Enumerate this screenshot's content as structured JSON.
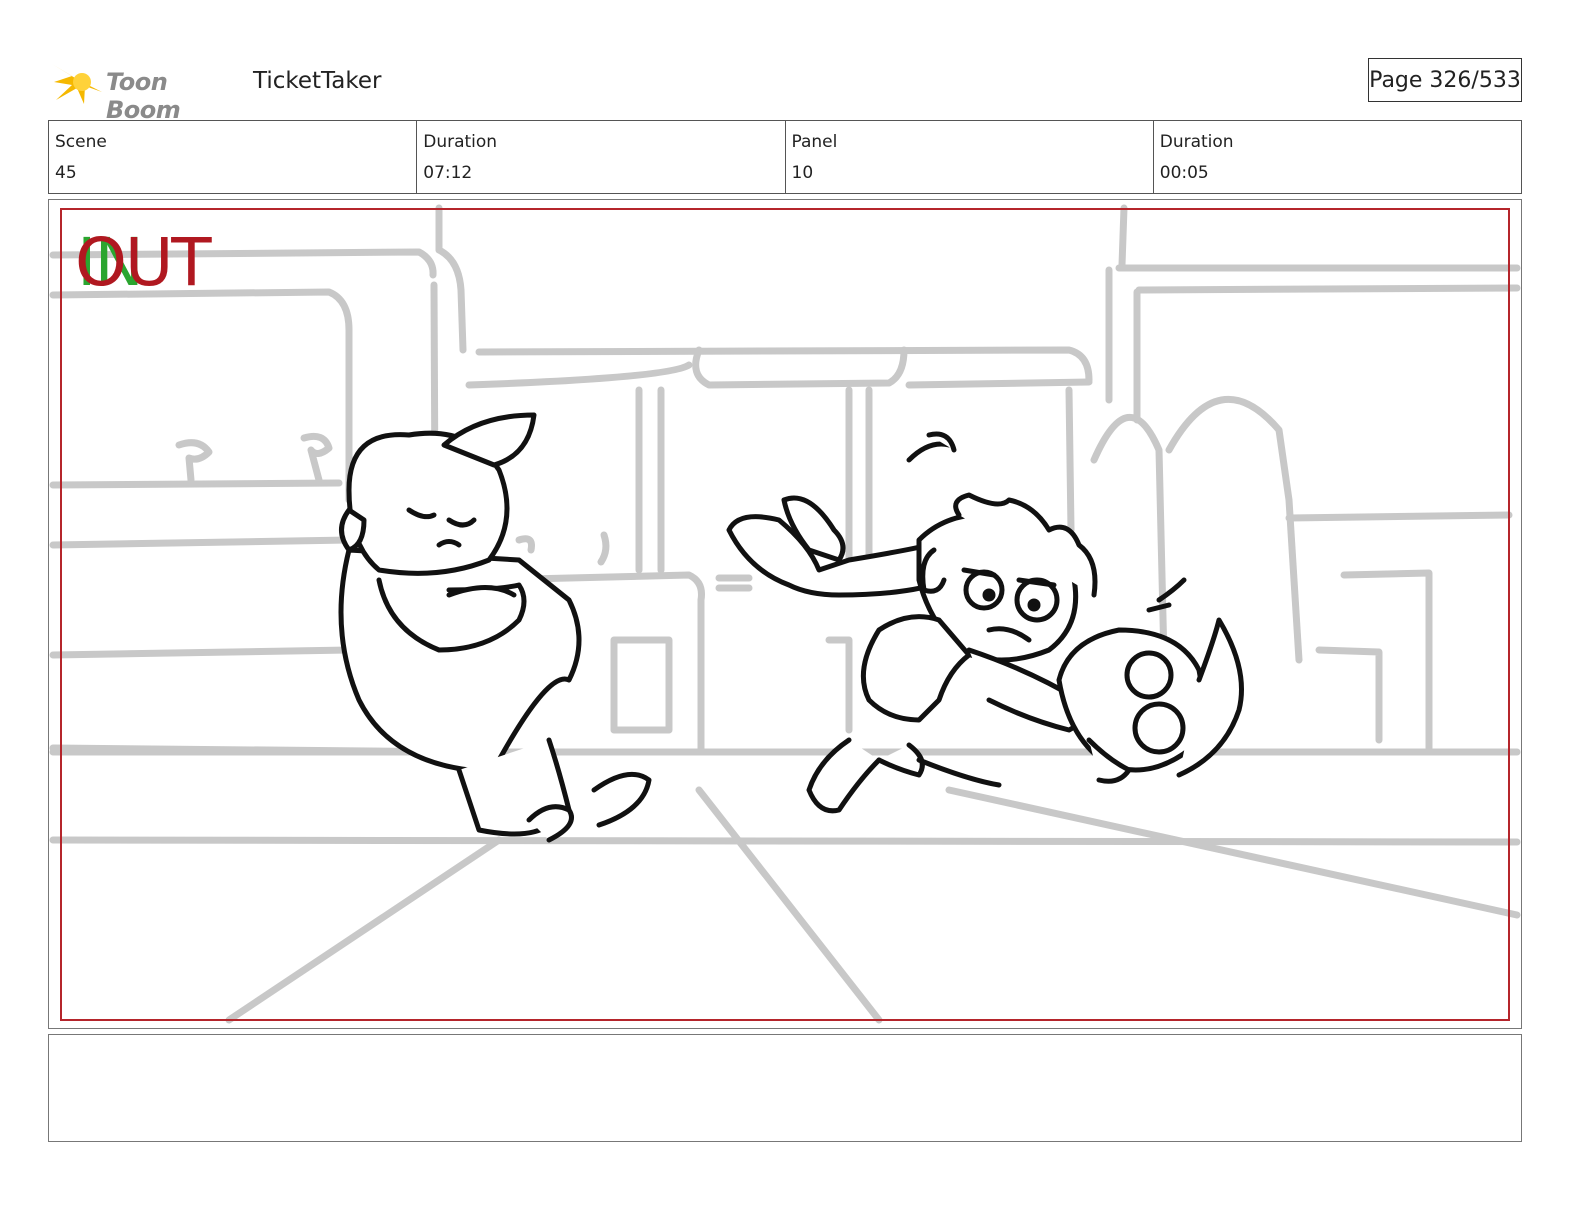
{
  "header": {
    "logo_text": "Toon Boom",
    "project_title": "TicketTaker",
    "page_indicator": "Page 326/533"
  },
  "info": {
    "scene_label": "Scene",
    "scene_value": "45",
    "scene_duration_label": "Duration",
    "scene_duration_value": "07:12",
    "panel_label": "Panel",
    "panel_value": "10",
    "panel_duration_label": "Duration",
    "panel_duration_value": "00:05"
  },
  "panel": {
    "in_marker": "IN",
    "out_marker": "OUT",
    "safe_frame_color": "#b5252b",
    "in_color": "#2aa52f",
    "out_color": "#b01820"
  },
  "notes": {
    "text": ""
  }
}
